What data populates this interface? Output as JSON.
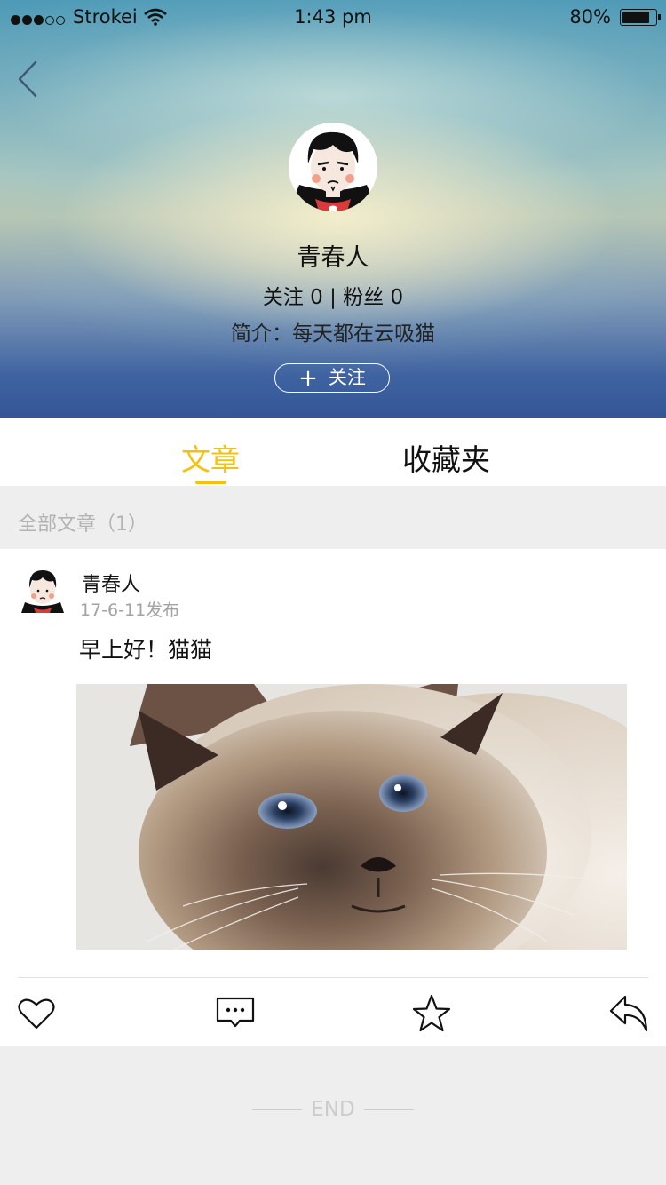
{
  "status_bar": {
    "carrier": "Strokei",
    "time": "1:43 pm",
    "battery": "80%",
    "signal_dots_filled": 3,
    "signal_dots_total": 5
  },
  "profile": {
    "name": "青春人",
    "stats": "关注 0 | 粉丝 0",
    "bio": "简介：每天都在云吸猫",
    "follow_label": "关注"
  },
  "tabs": [
    {
      "label": "文章",
      "active": true
    },
    {
      "label": "收藏夹",
      "active": false
    }
  ],
  "section": {
    "title": "全部文章（1）"
  },
  "post": {
    "author": "青春人",
    "date": "17-6-11发布",
    "title": "早上好！猫猫"
  },
  "actions": [
    "heart-icon",
    "comment-icon",
    "star-icon",
    "share-icon"
  ],
  "footer": {
    "end": "END"
  },
  "colors": {
    "accent": "#f4c20d",
    "background": "#eeeeee"
  }
}
